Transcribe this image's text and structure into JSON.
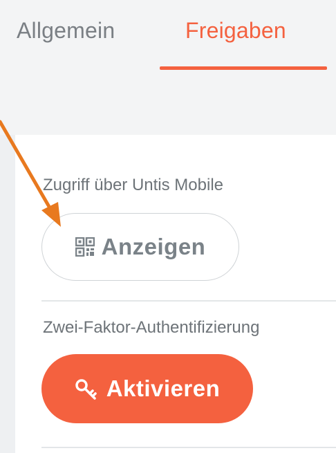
{
  "tabs": [
    {
      "label": "Allgemein",
      "active": false
    },
    {
      "label": "Freigaben",
      "active": true
    }
  ],
  "sections": {
    "mobile_access": {
      "label": "Zugriff über Untis Mobile",
      "button_label": "Anzeigen",
      "button_icon": "qr-code-icon"
    },
    "two_factor": {
      "label": "Zwei-Faktor-Authentifizierung",
      "button_label": "Aktivieren",
      "button_icon": "key-icon"
    }
  },
  "colors": {
    "accent": "#f4613f",
    "annotation_arrow": "#e8791f",
    "muted_text": "#7a7f84"
  }
}
